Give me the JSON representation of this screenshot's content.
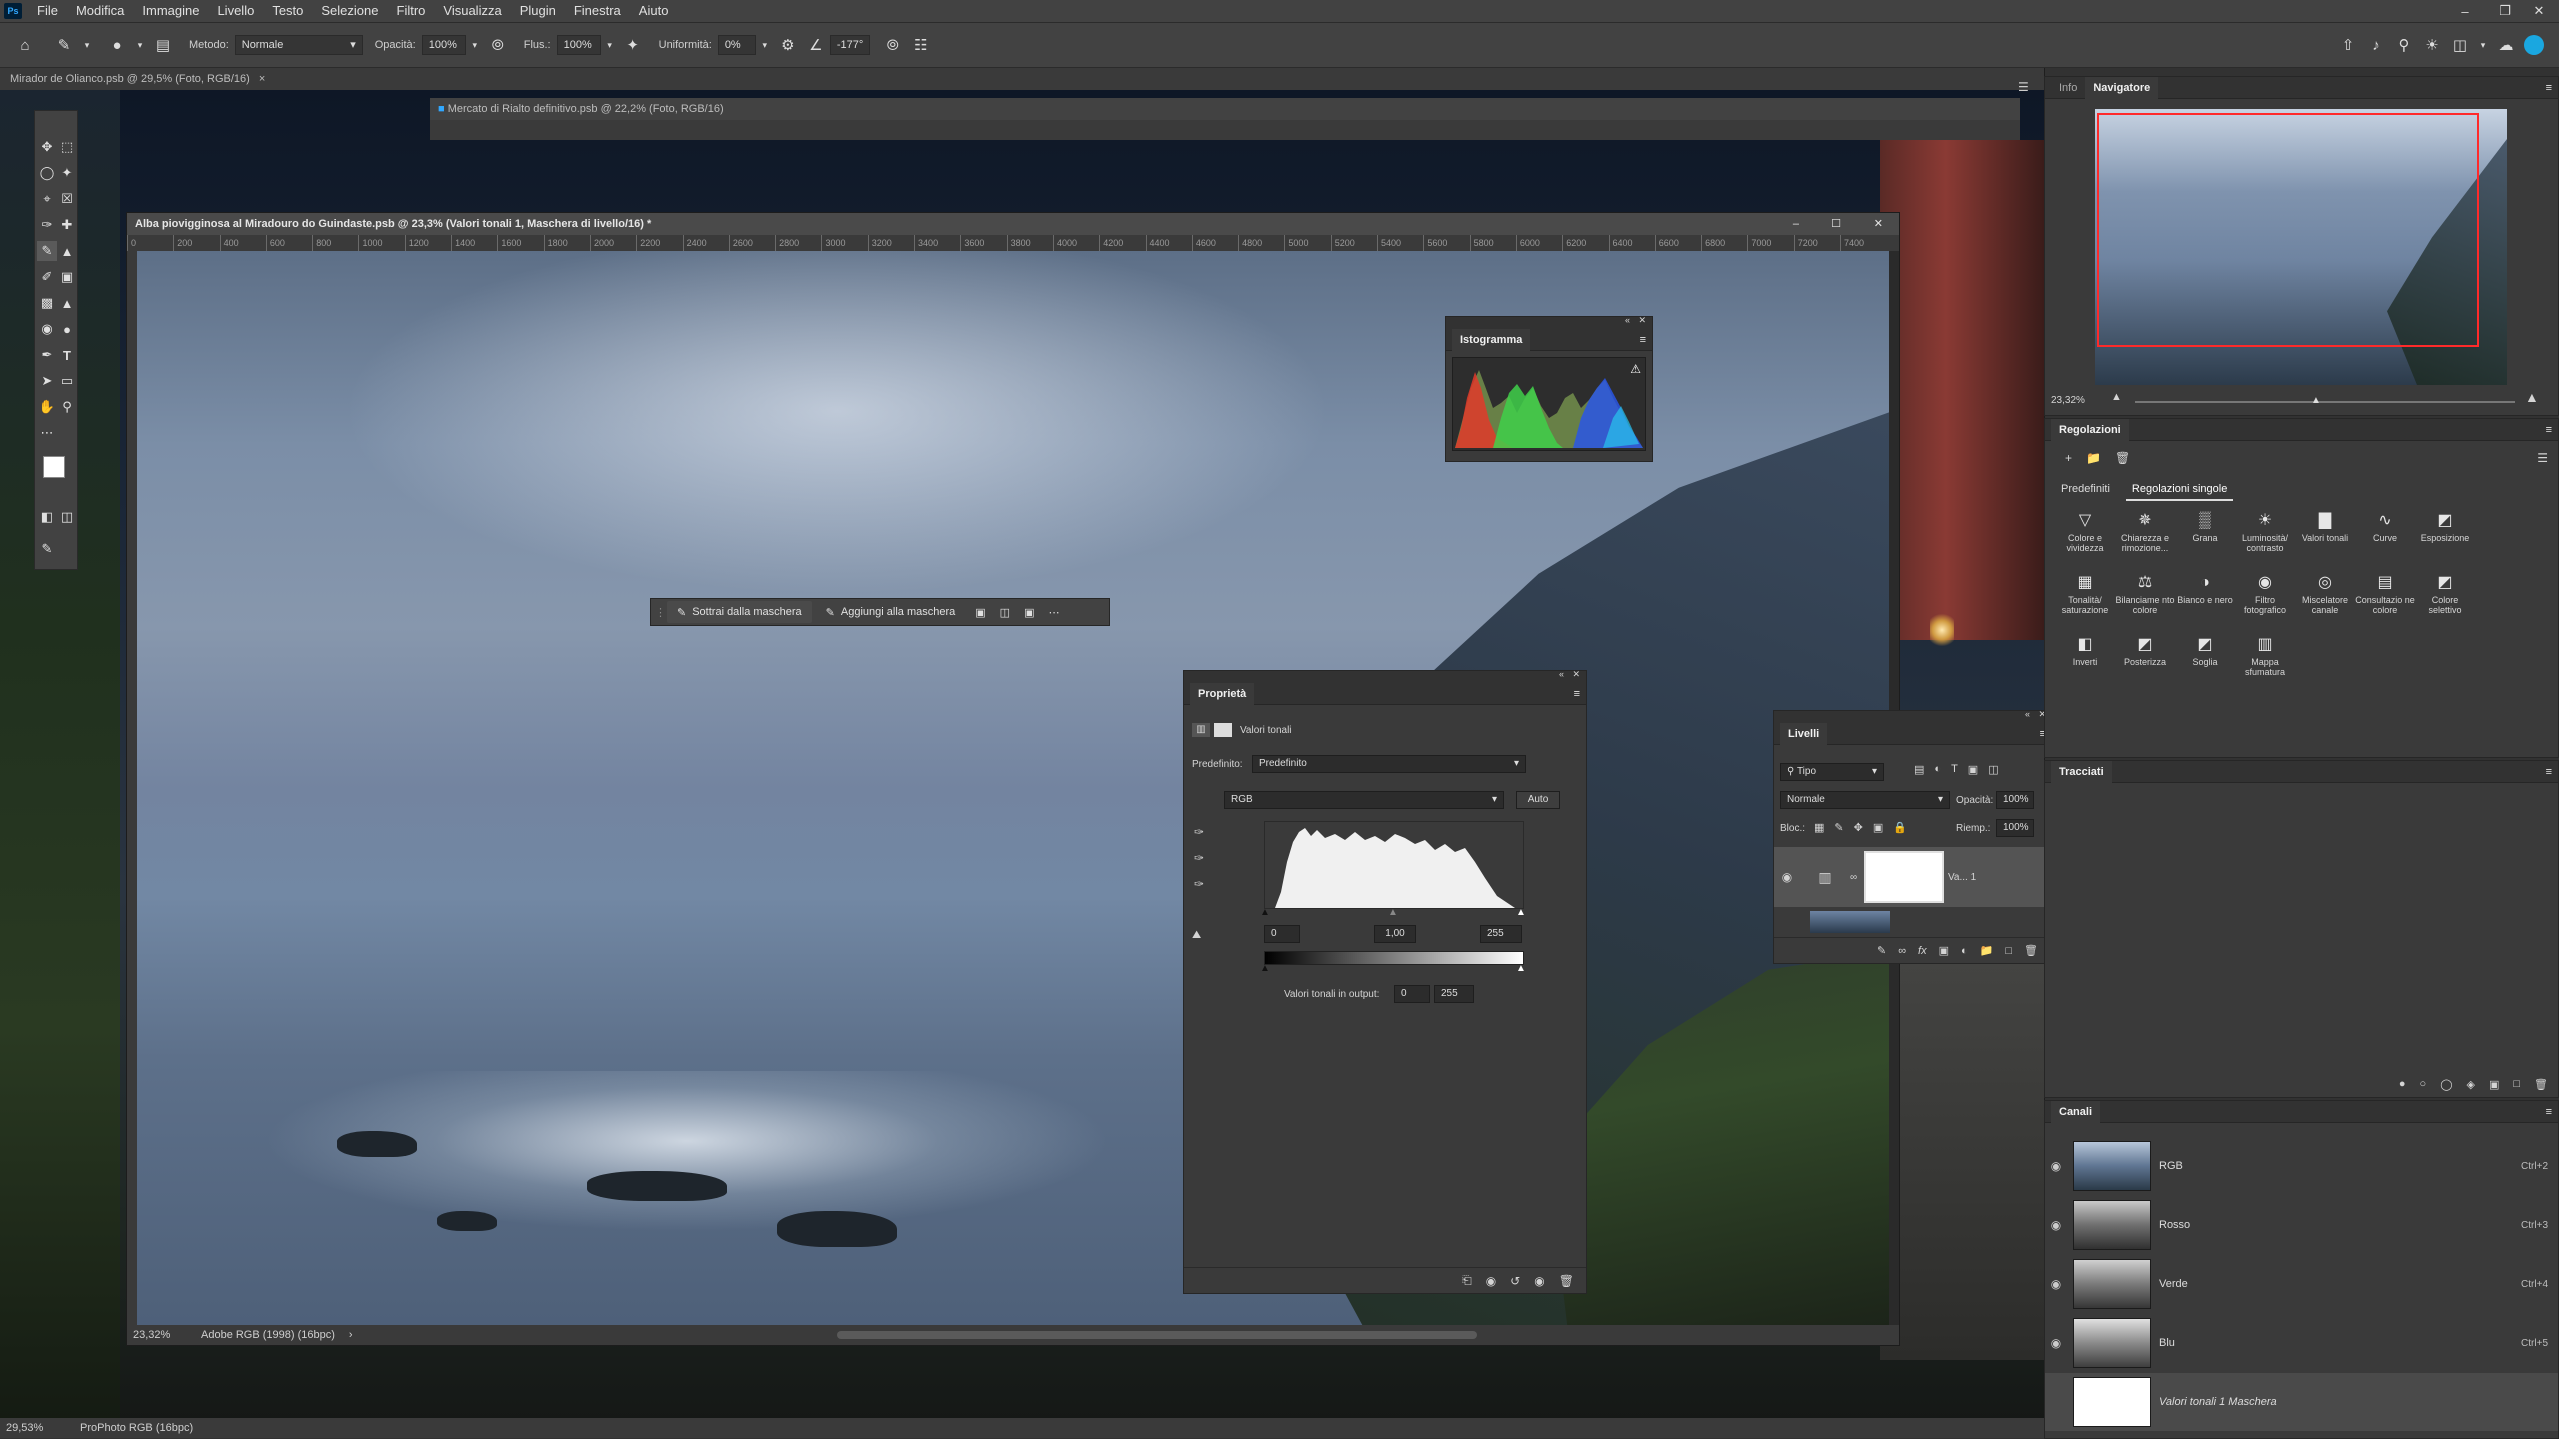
{
  "menu": {
    "logo": "Ps",
    "items": [
      "File",
      "Modifica",
      "Immagine",
      "Livello",
      "Testo",
      "Selezione",
      "Filtro",
      "Visualizza",
      "Plugin",
      "Finestra",
      "Aiuto"
    ]
  },
  "options_bar": {
    "metodo_label": "Metodo:",
    "metodo_value": "Normale",
    "opacita_label": "Opacità:",
    "opacita_value": "100%",
    "flusso_label": "Flus.:",
    "flusso_value": "100%",
    "uniformita_label": "Uniformità:",
    "uniformita_value": "0%",
    "angle_value": "-177°"
  },
  "tabs": {
    "back_doc_title": "Mirador de Olianco.psb @ 29,5% (Foto, RGB/16)"
  },
  "mid_doc": {
    "title": "Mercato di Rialto definitivo.psb @ 22,2% (Foto, RGB/16)"
  },
  "front_doc": {
    "title": "Alba piovigginosa al Miradouro do Guindaste.psb @ 23,3% (Valori tonali 1, Maschera di livello/16) *",
    "ruler_ticks": [
      "0",
      "200",
      "400",
      "600",
      "800",
      "1000",
      "1200",
      "1400",
      "1600",
      "1800",
      "2000",
      "2200",
      "2400",
      "2600",
      "2800",
      "3000",
      "3200",
      "3400",
      "3600",
      "3800",
      "4000",
      "4200",
      "4400",
      "4600",
      "4800",
      "5000",
      "5200",
      "5400",
      "5600",
      "5800",
      "6000",
      "6200",
      "6400",
      "6600",
      "6800",
      "7000",
      "7200",
      "7400"
    ],
    "zoom": "23,32%",
    "profile": "Adobe RGB (1998) (16bpc)"
  },
  "mask_toolbar": {
    "subtract": "Sottrai dalla maschera",
    "add": "Aggiungi alla maschera"
  },
  "histogram_panel": {
    "title": "Istogramma"
  },
  "properties_panel": {
    "title": "Proprietà",
    "type_label": "Valori tonali",
    "preset_label": "Predefinito:",
    "preset_value": "Predefinito",
    "channel_value": "RGB",
    "auto_button": "Auto",
    "input_black": "0",
    "input_gamma": "1,00",
    "input_white": "255",
    "output_label": "Valori tonali in output:",
    "output_black": "0",
    "output_white": "255"
  },
  "layers_panel": {
    "title": "Livelli",
    "filter_value": "Tipo",
    "blend_value": "Normale",
    "opacity_label": "Opacità:",
    "opacity_value": "100%",
    "lock_label": "Bloc.:",
    "fill_label": "Riemp.:",
    "fill_value": "100%",
    "layer_name": "Va... 1"
  },
  "right_panels": {
    "info_tab": "Info",
    "navigator_tab": "Navigatore",
    "navigator_zoom": "23,32%",
    "adjustments_title": "Regolazioni",
    "presets_tab": "Predefiniti",
    "single_tab": "Regolazioni singole",
    "adjustments": [
      {
        "label": "Colore e vividezza",
        "icon": "triangle-icon"
      },
      {
        "label": "Chiarezza e rimozione...",
        "icon": "haze-icon"
      },
      {
        "label": "Grana",
        "icon": "grain-icon"
      },
      {
        "label": "Luminosità/ contrasto",
        "icon": "sun-icon"
      },
      {
        "label": "Valori tonali",
        "icon": "levels-icon"
      },
      {
        "label": "Curve",
        "icon": "curves-icon"
      },
      {
        "label": "Esposizione",
        "icon": "exposure-icon"
      },
      {
        "label": "Tonalità/ saturazione",
        "icon": "hue-icon"
      },
      {
        "label": "Bilanciame nto colore",
        "icon": "balance-icon"
      },
      {
        "label": "Bianco e nero",
        "icon": "bw-icon"
      },
      {
        "label": "Filtro fotografico",
        "icon": "camera-icon"
      },
      {
        "label": "Miscelatore canale",
        "icon": "mixer-icon"
      },
      {
        "label": "Consultazio ne colore",
        "icon": "lookup-icon"
      },
      {
        "label": "Colore selettivo",
        "icon": "selective-icon"
      },
      {
        "label": "Inverti",
        "icon": "invert-icon"
      },
      {
        "label": "Posterizza",
        "icon": "posterize-icon"
      },
      {
        "label": "Soglia",
        "icon": "threshold-icon"
      },
      {
        "label": "Mappa sfumatura",
        "icon": "gradient-map-icon"
      }
    ],
    "paths_title": "Tracciati",
    "channels_title": "Canali",
    "channels": [
      {
        "name": "RGB",
        "shortcut": "Ctrl+2"
      },
      {
        "name": "Rosso",
        "shortcut": "Ctrl+3"
      },
      {
        "name": "Verde",
        "shortcut": "Ctrl+4"
      },
      {
        "name": "Blu",
        "shortcut": "Ctrl+5"
      },
      {
        "name": "Valori tonali 1 Maschera",
        "shortcut": ""
      }
    ]
  },
  "bottom_status": {
    "zoom": "29,53%",
    "profile": "ProPhoto RGB (16bpc)"
  }
}
